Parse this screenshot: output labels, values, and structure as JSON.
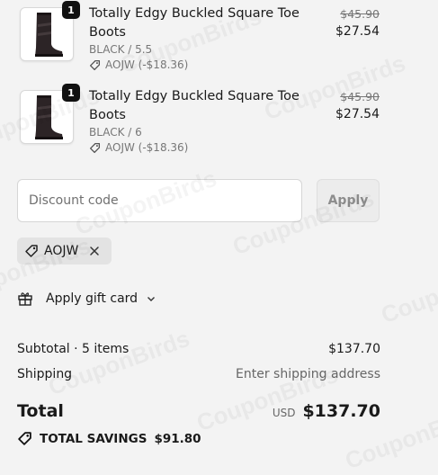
{
  "watermark": "CouponBirds",
  "items": [
    {
      "quantity": "1",
      "title": "Totally Edgy Buckled Square Toe Boots",
      "variant": "BLACK / 5.5",
      "discount": "AOJW (-$18.36)",
      "original_price": "$45.90",
      "price": "$27.54"
    },
    {
      "quantity": "1",
      "title": "Totally Edgy Buckled Square Toe Boots",
      "variant": "BLACK / 6",
      "discount": "AOJW (-$18.36)",
      "original_price": "$45.90",
      "price": "$27.54"
    }
  ],
  "discount": {
    "placeholder": "Discount code",
    "apply_label": "Apply",
    "applied_code": "AOJW"
  },
  "gift_card": {
    "label": "Apply gift card"
  },
  "summary": {
    "subtotal_label": "Subtotal · 5 items",
    "subtotal_value": "$137.70",
    "shipping_label": "Shipping",
    "shipping_value": "Enter shipping address",
    "total_label": "Total",
    "currency": "USD",
    "total_value": "$137.70",
    "savings_label": "TOTAL SAVINGS",
    "savings_value": "$91.80"
  },
  "colors": {
    "background": "#f3f3f3",
    "text": "#1a1a1a",
    "muted": "#777777"
  },
  "icons": [
    "tag-icon",
    "gift-icon",
    "chevron-down-icon",
    "close-icon"
  ]
}
